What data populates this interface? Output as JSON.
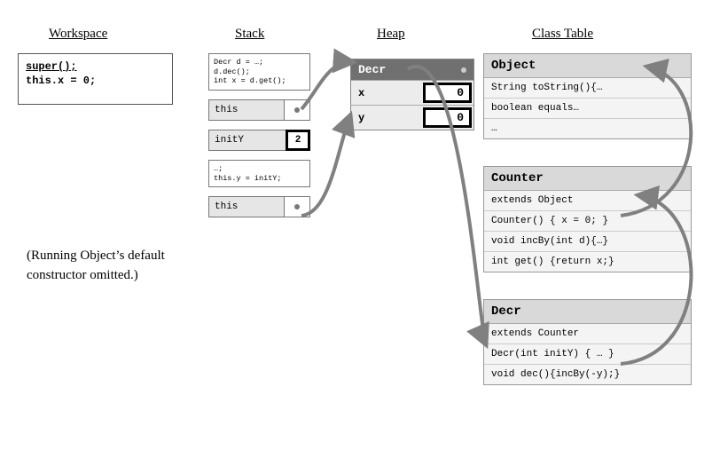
{
  "headings": {
    "workspace": "Workspace",
    "stack": "Stack",
    "heap": "Heap",
    "class_table": "Class Table"
  },
  "workspace": {
    "line1": "super();",
    "line2": "this.x = 0;"
  },
  "stack": {
    "frame1_code": "Decr d = …;\nd.dec();\nint x = d.get();",
    "this1_label": "this",
    "initY_label": "initY",
    "initY_val": "2",
    "frame2_code": "…;\nthis.y = initY;",
    "this2_label": "this"
  },
  "heap": {
    "class_ref": "Decr",
    "fields": [
      {
        "name": "x",
        "value": "0"
      },
      {
        "name": "y",
        "value": "0"
      }
    ]
  },
  "class_table": {
    "object": {
      "name": "Object",
      "rows": [
        "String toString(){…",
        "boolean equals…",
        "…"
      ]
    },
    "counter": {
      "name": "Counter",
      "rows": [
        "extends Object",
        "Counter() { x = 0; }",
        "void incBy(int d){…}",
        "int get() {return x;}"
      ]
    },
    "decr": {
      "name": "Decr",
      "rows": [
        "extends Counter",
        "Decr(int initY) { … }",
        "void dec(){incBy(-y);}"
      ]
    }
  },
  "note": "(Running Object’s default constructor omitted.)"
}
